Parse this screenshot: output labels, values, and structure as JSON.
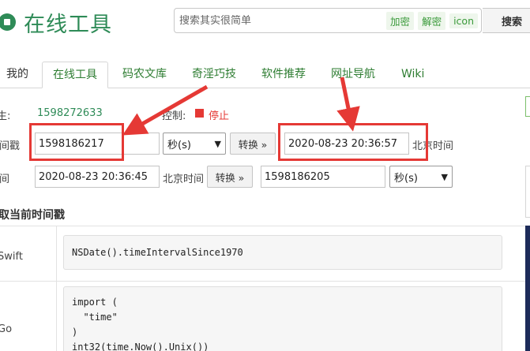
{
  "header": {
    "logo_text": "在线工具",
    "search_placeholder": "搜索其实很简单",
    "search_tags": [
      "加密",
      "解密",
      "icon"
    ],
    "search_button": "搜索"
  },
  "nav": {
    "tabs": [
      {
        "label": "我的"
      },
      {
        "label": "在线工具"
      },
      {
        "label": "码农文库"
      },
      {
        "label": "奇淫巧技"
      },
      {
        "label": "软件推荐"
      },
      {
        "label": "网址导航"
      },
      {
        "label": "Wiki"
      }
    ],
    "active_index": 1
  },
  "status": {
    "current_label": "生:",
    "current_value": "1598272633",
    "control_label": "控制:",
    "stop_label": "停止"
  },
  "row1": {
    "label": "间戳",
    "timestamp_value": "1598186217",
    "unit": "秒(s)",
    "convert_button": "转换 »",
    "result_value": "2020-08-23 20:36:57",
    "result_suffix": "北京时间"
  },
  "row2": {
    "label": "间",
    "datetime_value": "2020-08-23 20:36:45",
    "datetime_suffix": "北京时间",
    "convert_button": "转换 »",
    "result_value": "1598186205",
    "unit": "秒(s)"
  },
  "section": {
    "title": "取当前时间戳"
  },
  "code_table": [
    {
      "lang": "Swift",
      "code": [
        "NSDate().timeIntervalSince1970"
      ]
    },
    {
      "lang": "Go",
      "code": [
        "import (",
        "  \"time\"",
        ")",
        "int32(time.Now().Unix())"
      ]
    }
  ],
  "colors": {
    "brand_green": "#2e8b57",
    "annotation_red": "#e53935"
  }
}
